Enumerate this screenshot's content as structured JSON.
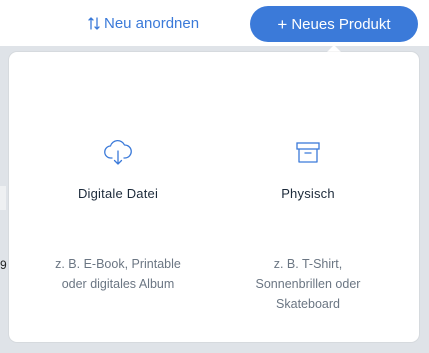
{
  "toolbar": {
    "reorder_label": "Neu anordnen",
    "new_product_label": "Neues Produkt",
    "new_product_plus": "+"
  },
  "background": {
    "edge_digit": "9"
  },
  "options": [
    {
      "title": "Digitale Datei",
      "desc_line1": "z. B. E-Book, Printable",
      "desc_line2": "oder digitales Album",
      "icon": "cloud-download-icon"
    },
    {
      "title": "Physisch",
      "desc_line1": "z. B. T-Shirt,",
      "desc_line2": "Sonnenbrillen oder",
      "desc_line3": "Skateboard",
      "icon": "archive-box-icon"
    }
  ],
  "colors": {
    "accent": "#3b7ad9",
    "title": "#1c2a3a",
    "muted": "#6b7683",
    "backdrop": "#dfe3e8"
  }
}
